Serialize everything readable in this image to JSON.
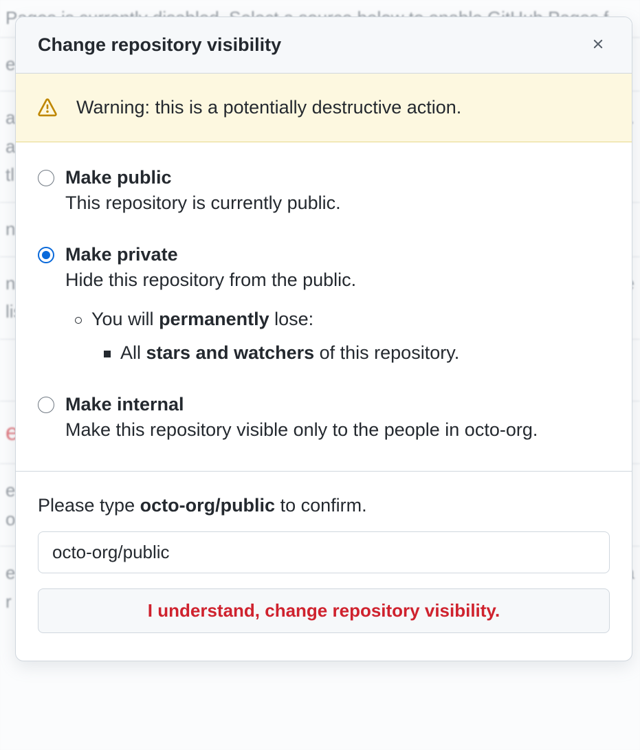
{
  "background": {
    "top_line": "Pages is currently disabled. Select a source below to enable GitHub Pages f",
    "frag1": "e",
    "frag2": "at",
    "frag3": "a",
    "frag4": "r.",
    "frag5": "tl",
    "frag6": "nc",
    "frag7": "n",
    "frag8": "lis",
    "frag9": "ge",
    "frag10": "r",
    "frag11": "e",
    "frag12": "e",
    "frag13": "oc",
    "frag14": "er",
    "frag15": "r",
    "frag16": "a"
  },
  "modal": {
    "title": "Change repository visibility",
    "warning": "Warning: this is a potentially destructive action.",
    "options": {
      "public": {
        "title": "Make public",
        "desc": "This repository is currently public."
      },
      "private": {
        "title": "Make private",
        "desc": "Hide this repository from the public.",
        "conseq_prefix": "You will ",
        "conseq_bold": "permanently",
        "conseq_suffix": " lose:",
        "sub_prefix": "All ",
        "sub_bold": "stars and watchers",
        "sub_suffix": " of this repository."
      },
      "internal": {
        "title": "Make internal",
        "desc": "Make this repository visible only to the people in octo-org."
      }
    },
    "confirm": {
      "prompt_prefix": "Please type ",
      "prompt_bold": "octo-org/public",
      "prompt_suffix": " to confirm.",
      "input_value": "octo-org/public",
      "button": "I understand, change repository visibility."
    }
  }
}
